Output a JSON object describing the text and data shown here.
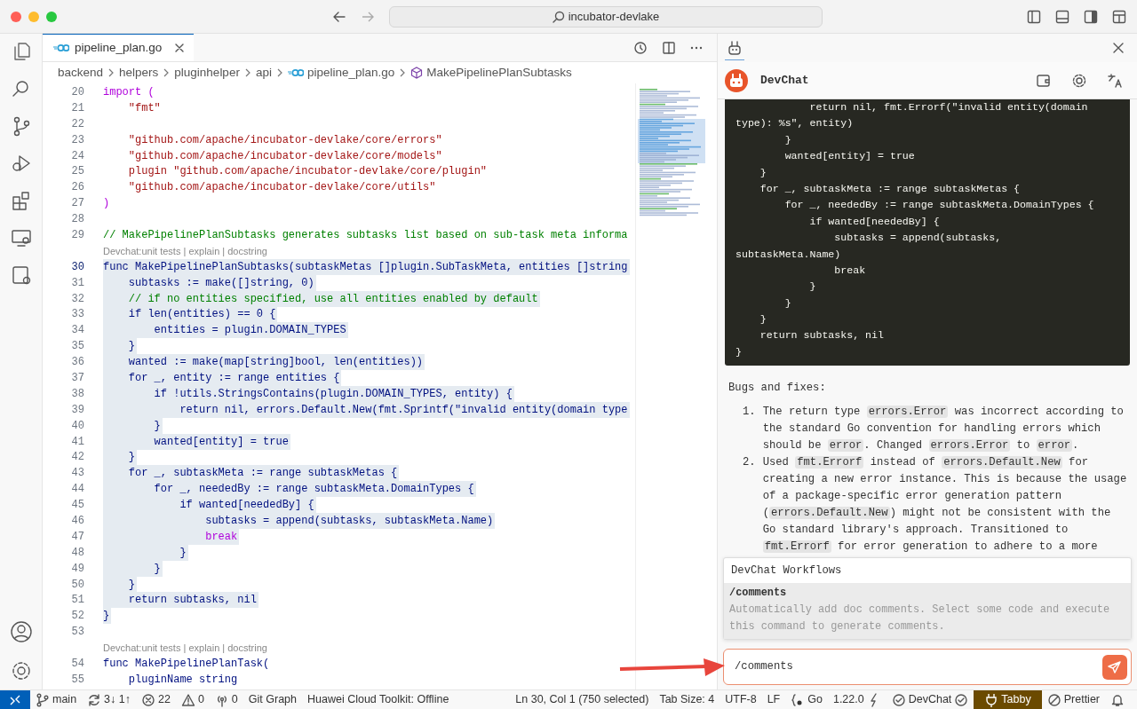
{
  "window": {
    "search": "incubator-devlake"
  },
  "editor": {
    "tabs": [
      {
        "label": "pipeline_plan.go",
        "selected": true
      }
    ],
    "breadcrumbs": [
      {
        "label": "backend",
        "kind": "folder"
      },
      {
        "label": "helpers",
        "kind": "folder"
      },
      {
        "label": "pluginhelper",
        "kind": "folder"
      },
      {
        "label": "api",
        "kind": "folder"
      },
      {
        "label": "pipeline_plan.go",
        "kind": "gofile"
      },
      {
        "label": "MakePipelinePlanSubtasks",
        "kind": "symbol"
      }
    ],
    "lines": [
      {
        "number": "20",
        "text": "import (",
        "kind": "keyword",
        "selected": false
      },
      {
        "number": "21",
        "text": "    \"fmt\"",
        "kind": "string",
        "selected": false
      },
      {
        "number": "22",
        "kind": "code",
        "selected": false
      },
      {
        "number": "23",
        "text": "    \"github.com/apache/incubator-devlake/core/errors\"",
        "kind": "string",
        "selected": false
      },
      {
        "number": "24",
        "text": "    \"github.com/apache/incubator-devlake/core/models\"",
        "kind": "string",
        "selected": false
      },
      {
        "number": "25",
        "text": "    plugin \"github.com/apache/incubator-devlake/core/plugin\"",
        "kind": "string",
        "selected": false
      },
      {
        "number": "26",
        "text": "    \"github.com/apache/incubator-devlake/core/utils\"",
        "kind": "string",
        "selected": false
      },
      {
        "number": "27",
        "text": ")",
        "kind": "keyword",
        "selected": false
      },
      {
        "number": "28",
        "kind": "code",
        "selected": false
      },
      {
        "number": "29",
        "text": "// MakePipelinePlanSubtasks generates subtasks list based on sub-task meta informa",
        "kind": "comment",
        "selected": false
      },
      {
        "text": "Devchat:unit tests | explain | docstring",
        "kind": "codelens"
      },
      {
        "number": "30",
        "text": "func MakePipelinePlanSubtasks(subtaskMetas []plugin.SubTaskMeta, entities []string",
        "kind": "code",
        "selected": true,
        "current": true
      },
      {
        "number": "31",
        "text": "    subtasks := make([]string, 0)",
        "kind": "code",
        "selected": true
      },
      {
        "number": "32",
        "text": "    // if no entities specified, use all entities enabled by default",
        "kind": "comment",
        "selected": true
      },
      {
        "number": "33",
        "text": "    if len(entities) == 0 {",
        "kind": "code",
        "selected": true
      },
      {
        "number": "34",
        "text": "        entities = plugin.DOMAIN_TYPES",
        "kind": "code",
        "selected": true
      },
      {
        "number": "35",
        "text": "    }",
        "kind": "code",
        "selected": true
      },
      {
        "number": "36",
        "text": "    wanted := make(map[string]bool, len(entities))",
        "kind": "code",
        "selected": true
      },
      {
        "number": "37",
        "text": "    for _, entity := range entities {",
        "kind": "code",
        "selected": true
      },
      {
        "number": "38",
        "text": "        if !utils.StringsContains(plugin.DOMAIN_TYPES, entity) {",
        "kind": "code",
        "selected": true
      },
      {
        "number": "39",
        "text": "            return nil, errors.Default.New(fmt.Sprintf(\"invalid entity(domain type",
        "kind": "code",
        "selected": true
      },
      {
        "number": "40",
        "text": "        }",
        "kind": "code",
        "selected": true
      },
      {
        "number": "41",
        "text": "        wanted[entity] = true",
        "kind": "code",
        "selected": true
      },
      {
        "number": "42",
        "text": "    }",
        "kind": "code",
        "selected": true
      },
      {
        "number": "43",
        "text": "    for _, subtaskMeta := range subtaskMetas {",
        "kind": "code",
        "selected": true
      },
      {
        "number": "44",
        "text": "        for _, neededBy := range subtaskMeta.DomainTypes {",
        "kind": "code",
        "selected": true
      },
      {
        "number": "45",
        "text": "            if wanted[neededBy] {",
        "kind": "code",
        "selected": true
      },
      {
        "number": "46",
        "text": "                subtasks = append(subtasks, subtaskMeta.Name)",
        "kind": "code",
        "selected": true
      },
      {
        "number": "47",
        "text": "                break",
        "kind": "keyword",
        "selected": true
      },
      {
        "number": "48",
        "text": "            }",
        "kind": "code",
        "selected": true
      },
      {
        "number": "49",
        "text": "        }",
        "kind": "code",
        "selected": true
      },
      {
        "number": "50",
        "text": "    }",
        "kind": "code",
        "selected": true
      },
      {
        "number": "51",
        "text": "    return subtasks, nil",
        "kind": "code",
        "selected": true
      },
      {
        "number": "52",
        "text": "}",
        "kind": "code",
        "selected": true
      },
      {
        "number": "53",
        "kind": "code",
        "selected": false
      },
      {
        "text": "Devchat:unit tests | explain | docstring",
        "kind": "codelens"
      },
      {
        "number": "54",
        "text": "func MakePipelinePlanTask(",
        "kind": "code",
        "selected": false
      },
      {
        "number": "55",
        "text": "    pluginName string",
        "kind": "code",
        "selected": false
      }
    ]
  },
  "chat": {
    "tabs": [
      {
        "selected": true
      }
    ],
    "title": "DevChat",
    "code_block": [
      "            return nil, fmt.Errorf(\"invalid entity(domain",
      "type): %s\", entity)",
      "        }",
      "        wanted[entity] = true",
      "    }",
      "    for _, subtaskMeta := range subtaskMetas {",
      "        for _, neededBy := range subtaskMeta.DomainTypes {",
      "            if wanted[neededBy] {",
      "                subtasks = append(subtasks,",
      "subtaskMeta.Name)",
      "                break",
      "            }",
      "        }",
      "    }",
      "    return subtasks, nil",
      "}"
    ],
    "heading": "Bugs and fixes:",
    "items": [
      {
        "marker": "1.",
        "parts": [
          {
            "text": "The return type "
          },
          {
            "text": "errors.Error",
            "code": true
          },
          {
            "text": " was incorrect according to the standard Go convention for handling errors which should be "
          },
          {
            "text": "error",
            "code": true
          },
          {
            "text": ". Changed "
          },
          {
            "text": "errors.Error",
            "code": true
          },
          {
            "text": " to "
          },
          {
            "text": "error",
            "code": true
          },
          {
            "text": "."
          }
        ]
      },
      {
        "marker": "2.",
        "parts": [
          {
            "text": "Used "
          },
          {
            "text": "fmt.Errorf",
            "code": true
          },
          {
            "text": " instead of "
          },
          {
            "text": "errors.Default.New",
            "code": true
          },
          {
            "text": " for creating a new error instance. This is because the usage of a package-specific error generation pattern ("
          },
          {
            "text": "errors.Default.New",
            "code": true
          },
          {
            "text": ") might not be consistent with the Go standard library's approach. Transitioned to "
          },
          {
            "text": "fmt.Errorf",
            "code": true
          },
          {
            "text": " for error generation to adhere to a more"
          }
        ]
      }
    ],
    "popup": {
      "title": "DevChat Workflows",
      "items": [
        {
          "name": "/comments",
          "description": "Automatically add doc comments. Select some code and execute this command to generate comments.",
          "selected": true
        }
      ]
    },
    "input": {
      "value": "/comments"
    }
  },
  "status_bar": {
    "left": [
      {
        "kind": "branch",
        "text": "main"
      },
      {
        "kind": "sync",
        "text": "3↓ 1↑"
      },
      {
        "kind": "error",
        "text": "22"
      },
      {
        "kind": "warning",
        "text": "0"
      },
      {
        "kind": "ports",
        "text": "0"
      },
      {
        "kind": "plain",
        "text": "Git Graph"
      },
      {
        "kind": "plain",
        "text": "Huawei Cloud Toolkit: Offline"
      }
    ],
    "right": [
      {
        "kind": "plain",
        "text": "Ln 30, Col 1 (750 selected)"
      },
      {
        "kind": "plain",
        "text": "Tab Size: 4"
      },
      {
        "kind": "plain",
        "text": "UTF-8"
      },
      {
        "kind": "plain",
        "text": "LF"
      },
      {
        "kind": "braces",
        "text": "Go"
      },
      {
        "kind": "bolt",
        "text": "1.22.0"
      },
      {
        "kind": "check",
        "text": "DevChat"
      },
      {
        "kind": "plug",
        "text": "Tabby",
        "highlighted": true
      },
      {
        "kind": "blocked",
        "text": "Prettier"
      }
    ]
  }
}
